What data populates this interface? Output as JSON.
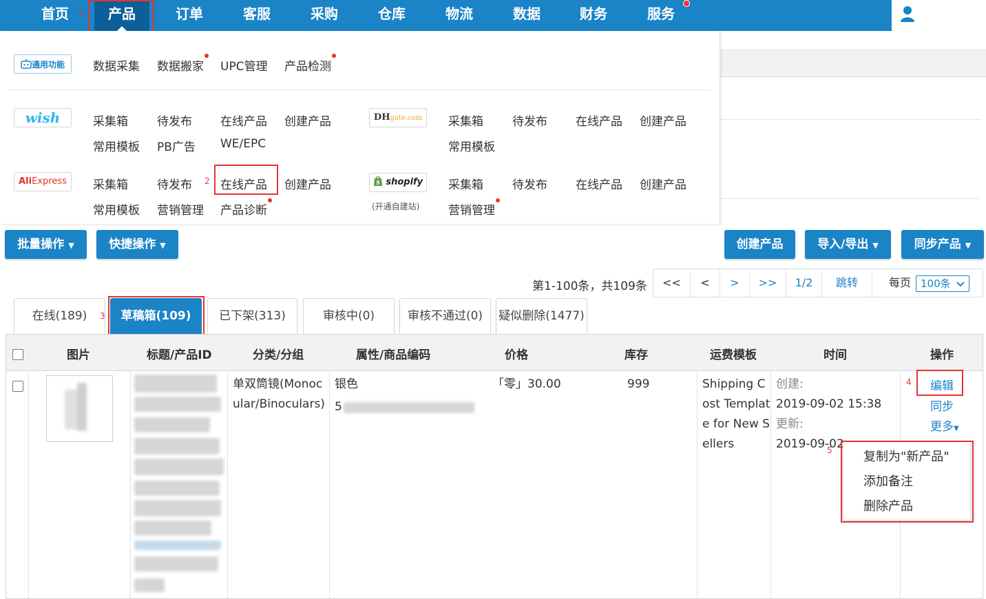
{
  "nav": {
    "items": [
      "首页",
      "产品",
      "订单",
      "客服",
      "采购",
      "仓库",
      "物流",
      "数据",
      "财务",
      "服务"
    ],
    "active_index": 1
  },
  "annotations": [
    "1",
    "2",
    "3",
    "4",
    "5"
  ],
  "mega_menu": {
    "general": {
      "logo": "通用功能",
      "links": [
        "数据采集",
        "数据搬家",
        "UPC管理",
        "产品检测"
      ]
    },
    "wish": {
      "logo": "wish",
      "row1": [
        "采集箱",
        "待发布",
        "在线产品",
        "创建产品"
      ],
      "row2": [
        "常用模板",
        "PB广告",
        "WE/EPC"
      ]
    },
    "dhgate": {
      "logo_main": "DH",
      "logo_tail": "gate.com",
      "row1": [
        "采集箱",
        "待发布",
        "在线产品",
        "创建产品"
      ],
      "row2": [
        "常用模板"
      ]
    },
    "aliexpress": {
      "logo_a": "Ali",
      "logo_b": "Express",
      "row1": [
        "采集箱",
        "待发布",
        "在线产品",
        "创建产品"
      ],
      "row2": [
        "常用模板",
        "营销管理",
        "产品诊断"
      ]
    },
    "shopify": {
      "logo": "shopify",
      "note": "(开通自建站)",
      "row1": [
        "采集箱",
        "待发布",
        "在线产品",
        "创建产品"
      ],
      "row2": [
        "营销管理"
      ]
    }
  },
  "toolbar": {
    "batch": "批量操作",
    "quick": "快捷操作",
    "create": "创建产品",
    "import_export": "导入/导出",
    "sync": "同步产品"
  },
  "pagination": {
    "range_text": "第1-100条，共109条",
    "first": "<<",
    "prev": "<",
    "next": ">",
    "last": ">>",
    "page": "1/2",
    "jump": "跳转",
    "per_page_label": "每页",
    "per_page_value": "100条"
  },
  "tabs": [
    "在线(189)",
    "草稿箱(109)",
    "已下架(313)",
    "审核中(0)",
    "审核不通过(0)",
    "疑似删除(1477)"
  ],
  "active_tab": 1,
  "table": {
    "headers": [
      "图片",
      "标题/产品ID",
      "分类/分组",
      "属性/商品编码",
      "价格",
      "库存",
      "运费模板",
      "时间",
      "操作"
    ],
    "row": {
      "category": [
        "单双筒镜(Monoc",
        "ular/Binoculars)"
      ],
      "attr_color": "银色",
      "attr_code_prefix": "5",
      "price": "「零」30.00",
      "stock": "999",
      "shipping": [
        "Shipping C",
        "ost Templat",
        "e for New S",
        "ellers"
      ],
      "created_label": "创建:",
      "created_time": "2019-09-02 15:38",
      "updated_label": "更新:",
      "updated_time": "2019-09-02",
      "ops": {
        "edit": "编辑",
        "sync": "同步",
        "more": "更多"
      }
    }
  },
  "more_menu": [
    "复制为\"新产品\"",
    "添加备注",
    "删除产品"
  ],
  "colors": {
    "primary": "#1a84c7",
    "highlight": "#e53333"
  }
}
